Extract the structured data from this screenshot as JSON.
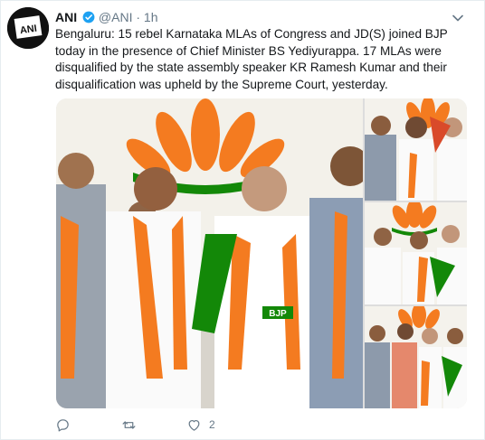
{
  "tweet": {
    "author_name": "ANI",
    "handle": "@ANI",
    "separator": "·",
    "time": "1h",
    "avatar_text": "ANI",
    "text": "Bengaluru: 15 rebel Karnataka MLAs of Congress and JD(S) joined BJP today in the presence of Chief Minister BS Yediyurappa. 17 MLAs were disqualified by the state assembly speaker KR Ramesh Kumar and their disqualification was upheld by the Supreme Court, yesterday.",
    "badge_text": "BJP"
  },
  "actions": {
    "reply_count": "",
    "retweet_count": "",
    "like_count": "2"
  },
  "colors": {
    "verified": "#1da1f2",
    "saffron": "#f47b20",
    "green": "#138808",
    "muted": "#657786"
  }
}
